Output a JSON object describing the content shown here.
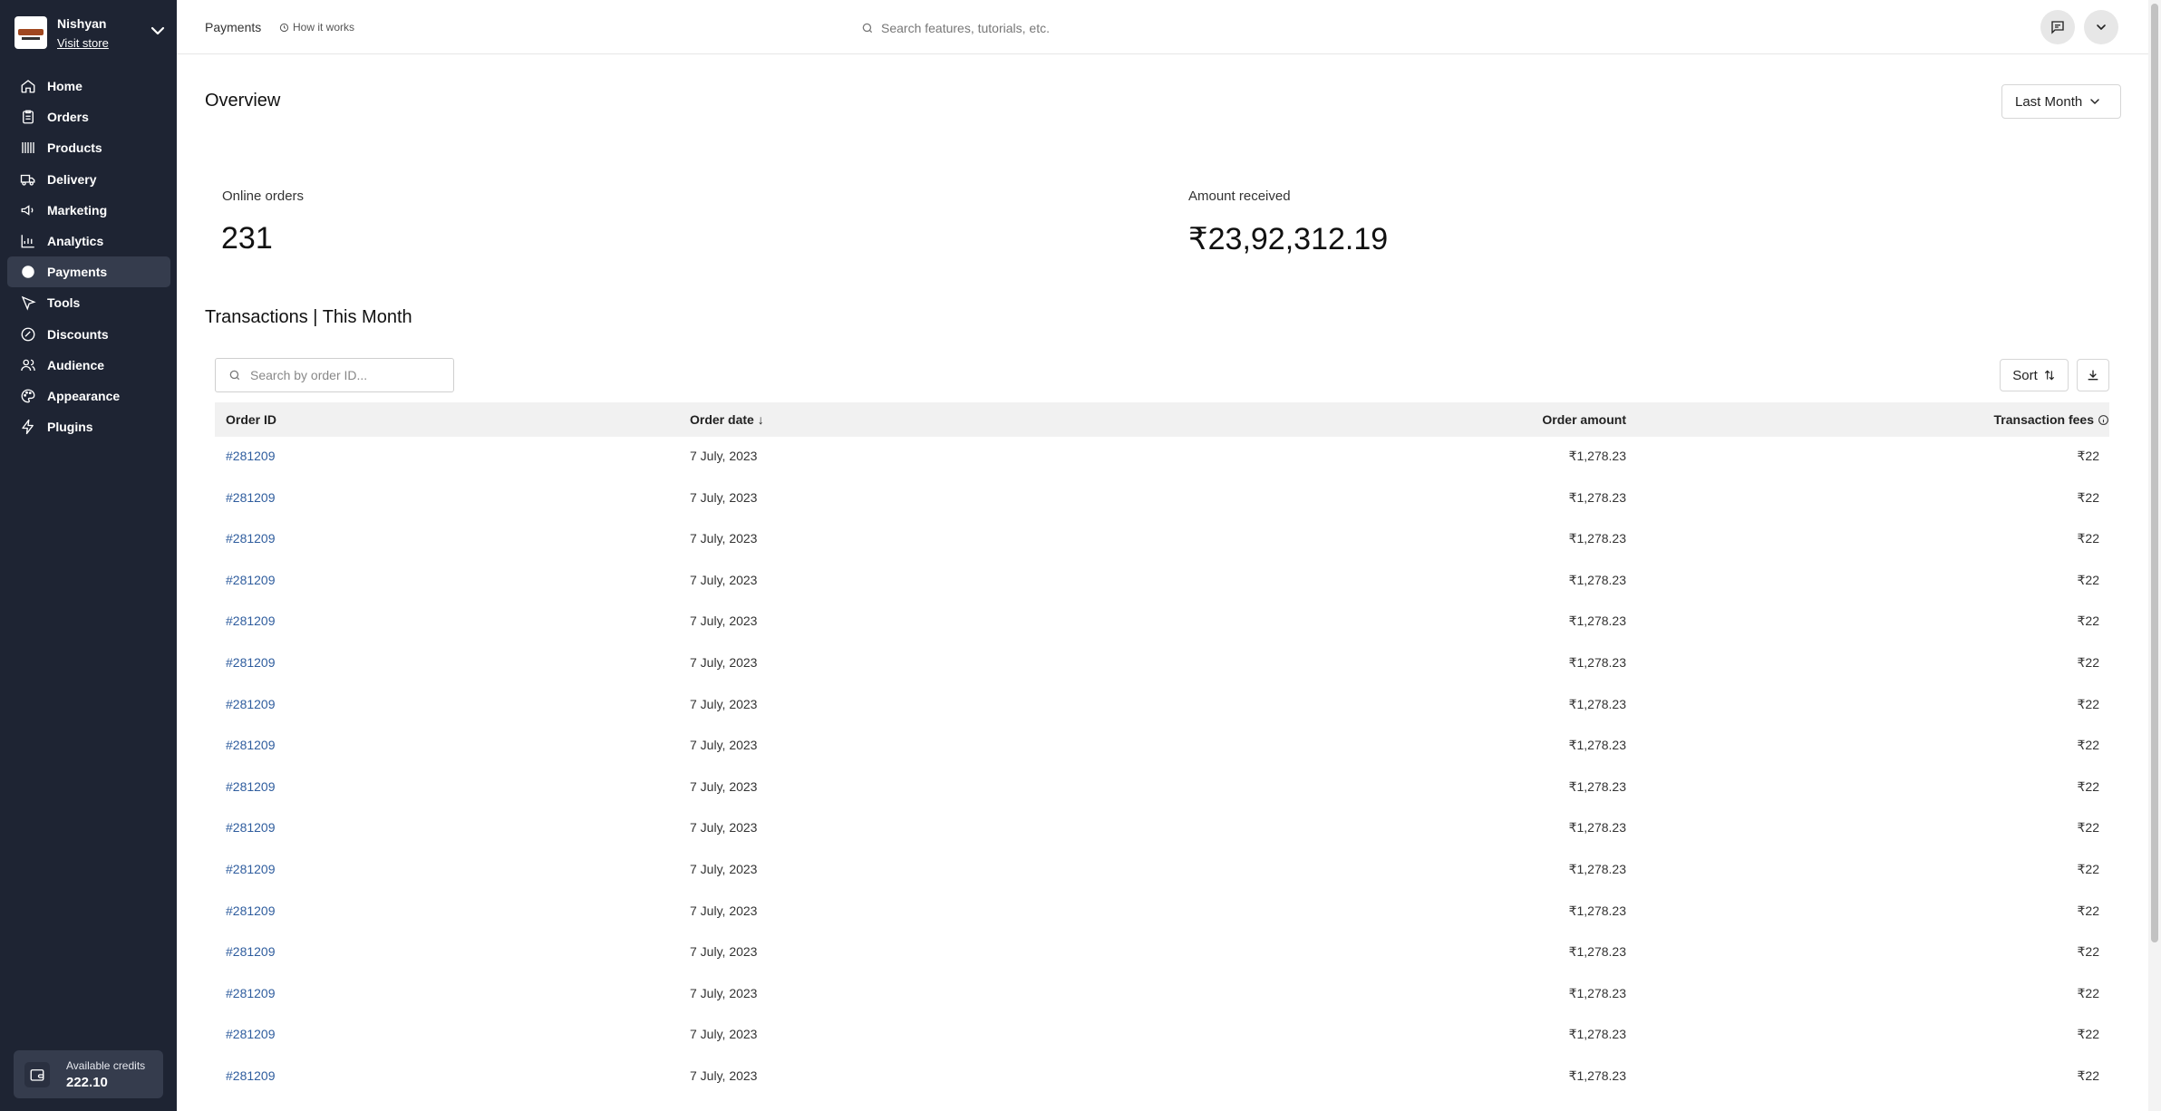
{
  "store": {
    "name": "Nishyan",
    "visit_link": "Visit store"
  },
  "nav": [
    {
      "label": "Home",
      "icon": "home-icon",
      "active": false
    },
    {
      "label": "Orders",
      "icon": "orders-icon",
      "active": false
    },
    {
      "label": "Products",
      "icon": "products-icon",
      "active": false
    },
    {
      "label": "Delivery",
      "icon": "truck-icon",
      "active": false
    },
    {
      "label": "Marketing",
      "icon": "megaphone-icon",
      "active": false
    },
    {
      "label": "Analytics",
      "icon": "chart-icon",
      "active": false
    },
    {
      "label": "Payments",
      "icon": "payments-icon",
      "active": true
    },
    {
      "label": "Tools",
      "icon": "cursor-icon",
      "active": false
    },
    {
      "label": "Discounts",
      "icon": "discount-icon",
      "active": false
    },
    {
      "label": "Audience",
      "icon": "users-icon",
      "active": false
    },
    {
      "label": "Appearance",
      "icon": "palette-icon",
      "active": false
    },
    {
      "label": "Plugins",
      "icon": "bolt-icon",
      "active": false
    }
  ],
  "credits": {
    "label": "Available credits",
    "value": "222.10"
  },
  "topbar": {
    "breadcrumb": "Payments",
    "how_it_works": "How it works",
    "search_placeholder": "Search features, tutorials, etc."
  },
  "overview": {
    "title": "Overview",
    "range": "Last Month",
    "stats": [
      {
        "label": "Online orders",
        "value": "231"
      },
      {
        "label": "Amount received",
        "value": "₹23,92,312.19"
      }
    ]
  },
  "transactions": {
    "title": "Transactions | This Month",
    "search_placeholder": "Search by order ID...",
    "sort_label": "Sort",
    "columns": [
      "Order ID",
      "Order date",
      "Order amount",
      "Transaction fees"
    ],
    "rows": [
      [
        "#281209",
        "7 July, 2023",
        "₹1,278.23",
        "₹22"
      ],
      [
        "#281209",
        "7 July, 2023",
        "₹1,278.23",
        "₹22"
      ],
      [
        "#281209",
        "7 July, 2023",
        "₹1,278.23",
        "₹22"
      ],
      [
        "#281209",
        "7 July, 2023",
        "₹1,278.23",
        "₹22"
      ],
      [
        "#281209",
        "7 July, 2023",
        "₹1,278.23",
        "₹22"
      ],
      [
        "#281209",
        "7 July, 2023",
        "₹1,278.23",
        "₹22"
      ],
      [
        "#281209",
        "7 July, 2023",
        "₹1,278.23",
        "₹22"
      ],
      [
        "#281209",
        "7 July, 2023",
        "₹1,278.23",
        "₹22"
      ],
      [
        "#281209",
        "7 July, 2023",
        "₹1,278.23",
        "₹22"
      ],
      [
        "#281209",
        "7 July, 2023",
        "₹1,278.23",
        "₹22"
      ],
      [
        "#281209",
        "7 July, 2023",
        "₹1,278.23",
        "₹22"
      ],
      [
        "#281209",
        "7 July, 2023",
        "₹1,278.23",
        "₹22"
      ],
      [
        "#281209",
        "7 July, 2023",
        "₹1,278.23",
        "₹22"
      ],
      [
        "#281209",
        "7 July, 2023",
        "₹1,278.23",
        "₹22"
      ],
      [
        "#281209",
        "7 July, 2023",
        "₹1,278.23",
        "₹22"
      ],
      [
        "#281209",
        "7 July, 2023",
        "₹1,278.23",
        "₹22"
      ]
    ]
  },
  "colors": {
    "sidebar_bg": "#1e2433",
    "sidebar_active": "#353c4d",
    "link": "#2f5d9e",
    "table_header_bg": "#f1f1f1"
  }
}
